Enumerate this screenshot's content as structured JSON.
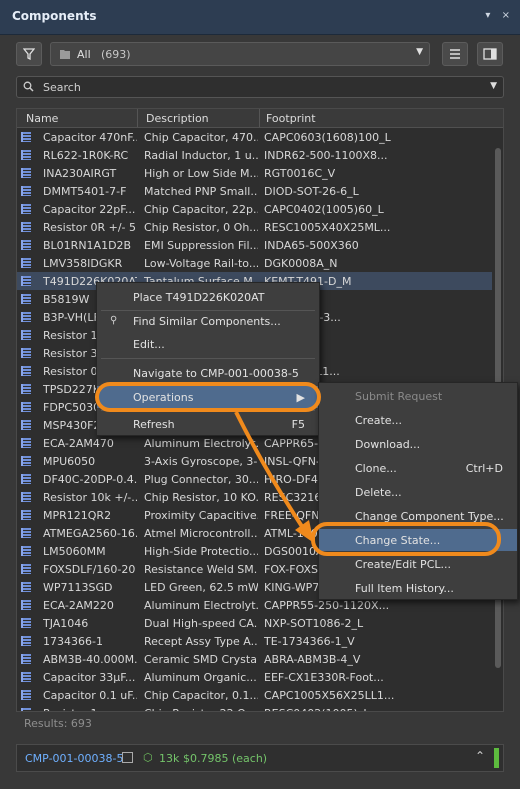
{
  "panel": {
    "title": "Components",
    "collapse_icon": "▾",
    "close_icon": "×"
  },
  "toolbar": {
    "filter_selected": "All",
    "filter_count": "(693)"
  },
  "search": {
    "placeholder": "Search"
  },
  "table": {
    "columns": [
      "Name",
      "Description",
      "Footprint"
    ],
    "rows": [
      [
        "Capacitor 470nF...",
        "Chip Capacitor, 470...",
        "CAPC0603(1608)100_L"
      ],
      [
        "RL622-1R0K-RC",
        "Radial Inductor, 1 u...",
        "INDR62-500-1100X8..."
      ],
      [
        "INA230AIRGT",
        "High or Low Side M...",
        "RGT0016C_V"
      ],
      [
        "DMMT5401-7-F",
        "Matched PNP Small...",
        "DIOD-SOT-26-6_L"
      ],
      [
        "Capacitor 22pF...",
        "Chip Capacitor, 22p...",
        "CAPC0402(1005)60_L"
      ],
      [
        "Resistor 0R +/- 5...",
        "Chip Resistor, 0 Oh...",
        "RESC1005X40X25ML..."
      ],
      [
        "BL01RN1A1D2B",
        "EMI Suppression Fil...",
        "INDA65-500X360"
      ],
      [
        "LMV358IDGKR",
        "Low-Voltage Rail-to...",
        "DGK0008A_N"
      ],
      [
        "T491D226K020AT",
        "Tantalum Surface M...",
        "KEMT-T491-D_M"
      ],
      [
        "B5819W",
        "",
        "...23_V"
      ],
      [
        "B3P-VH(LF)",
        "",
        "...(LF)(SN)-3..."
      ],
      [
        "Resistor 10",
        "",
        "...005)_L"
      ],
      [
        "Resistor 32",
        "",
        "...005)_L"
      ],
      [
        "Resistor 0R",
        "",
        "...50X35LL1..."
      ],
      [
        "TPSD227K0",
        "",
        ""
      ],
      [
        "FDPC5030S",
        "",
        ""
      ],
      [
        "MSP430F2",
        "",
        ""
      ],
      [
        "ECA-2AM470",
        "Aluminum Electrolyt...",
        "CAPPR65-3"
      ],
      [
        "MPU6050",
        "3-Axis Gyroscope, 3-...",
        "INSL-QFN-"
      ],
      [
        "DF40C-20DP-0.4...",
        "Plug Connector, 30...",
        "HIRO-DF4"
      ],
      [
        "Resistor 10k +/-...",
        "Chip Resistor, 10 KO...",
        "RESC3216"
      ],
      [
        "MPR121QR2",
        "Proximity Capacitive...",
        "FREE-QFN-"
      ],
      [
        "ATMEGA2560-16...",
        "Atmel Microcontroll...",
        "ATML-100"
      ],
      [
        "LM5060MM",
        "High-Side Protectio...",
        "DGS0010A"
      ],
      [
        "FOXSDLF/160-20",
        "Resistance Weld SM...",
        "FOX-FOXSD"
      ],
      [
        "WP7113SGD",
        "LED Green, 62.5 mW...",
        "KING-WP71"
      ],
      [
        "ECA-2AM220",
        "Aluminum Electrolyt...",
        "CAPPR55-250-1120X..."
      ],
      [
        "TJA1046",
        "Dual High-speed CA...",
        "NXP-SOT1086-2_L"
      ],
      [
        "1734366-1",
        "Recept Assy Type A...",
        "TE-1734366-1_V"
      ],
      [
        "ABM3B-40.000M...",
        "Ceramic SMD Crystal...",
        "ABRA-ABM3B-4_V"
      ],
      [
        "Capacitor 33µF...",
        "Aluminum Organic...",
        "EEF-CX1E330R-Foot..."
      ],
      [
        "Capacitor 0.1 uF...",
        "Chip Capacitor, 0.1...",
        "CAPC1005X56X25LL1..."
      ],
      [
        "Resistor 1...",
        "Chip Resistor 22 O...",
        "RESC0402(1005)_L"
      ]
    ]
  },
  "results": "Results: 693",
  "status": {
    "selected": "CMP-001-00038-5",
    "stock": "13k",
    "price": "$0.7985 (each)"
  },
  "context_menu": {
    "items": [
      {
        "label": "Place T491D226K020AT",
        "shortcut": ""
      },
      {
        "label": "Find Similar Components...",
        "shortcut": ""
      },
      {
        "label": "Edit...",
        "shortcut": ""
      },
      {
        "label": "Navigate to CMP-001-00038-5",
        "shortcut": ""
      },
      {
        "label": "Operations",
        "shortcut": "▶"
      },
      {
        "label": "Refresh",
        "shortcut": "F5"
      }
    ]
  },
  "submenu": {
    "items": [
      {
        "label": "Submit Request",
        "shortcut": ""
      },
      {
        "label": "Create...",
        "shortcut": ""
      },
      {
        "label": "Download...",
        "shortcut": ""
      },
      {
        "label": "Clone...",
        "shortcut": "Ctrl+D"
      },
      {
        "label": "Delete...",
        "shortcut": ""
      },
      {
        "label": "Change Component Type...",
        "shortcut": ""
      },
      {
        "label": "Change State...",
        "shortcut": ""
      },
      {
        "label": "Create/Edit PCL...",
        "shortcut": ""
      },
      {
        "label": "Full Item History...",
        "shortcut": ""
      }
    ]
  },
  "colors": {
    "accent": "#f08a1c",
    "highlight": "#4f6b8e",
    "link": "#6fb0ff",
    "stock": "#74c46a"
  }
}
